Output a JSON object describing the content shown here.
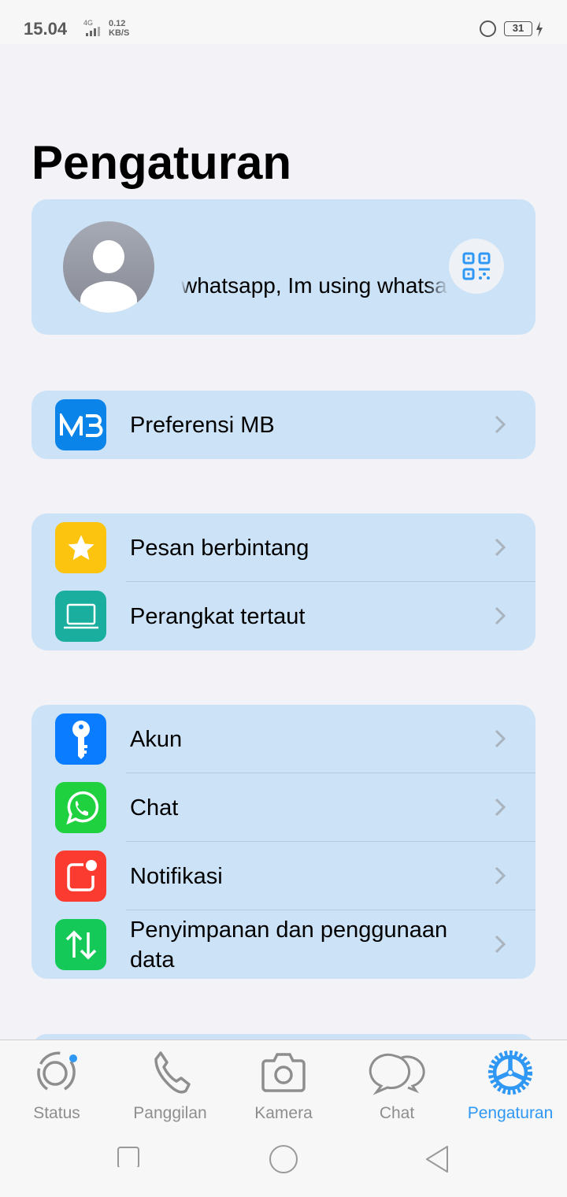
{
  "status_bar": {
    "time": "15.04",
    "network": "4G",
    "speed_value": "0.12",
    "speed_unit": "KB/S",
    "battery": "31"
  },
  "title": "Pengaturan",
  "profile": {
    "about": "whatsapp, Im using whatsapp"
  },
  "groups": [
    [
      {
        "label": "Preferensi MB",
        "icon": "mb-logo-icon",
        "color": "#0a84e8"
      }
    ],
    [
      {
        "label": "Pesan berbintang",
        "icon": "star-icon",
        "color": "#fdc40f"
      },
      {
        "label": "Perangkat tertaut",
        "icon": "laptop-icon",
        "color": "#1aae9f"
      }
    ],
    [
      {
        "label": "Akun",
        "icon": "key-icon",
        "color": "#0a7cff"
      },
      {
        "label": "Chat",
        "icon": "whatsapp-icon",
        "color": "#1fd13e"
      },
      {
        "label": "Notifikasi",
        "icon": "notification-icon",
        "color": "#fb3b30"
      },
      {
        "label": "Penyimpanan dan penggunaan data",
        "icon": "data-transfer-icon",
        "color": "#14c957"
      }
    ]
  ],
  "nav": {
    "tabs": [
      {
        "label": "Status"
      },
      {
        "label": "Panggilan"
      },
      {
        "label": "Kamera"
      },
      {
        "label": "Chat"
      },
      {
        "label": "Pengaturan",
        "active": true
      }
    ]
  },
  "colors": {
    "accent": "#2f97f4",
    "card": "#cce2f7",
    "background": "#f2f2f7"
  }
}
